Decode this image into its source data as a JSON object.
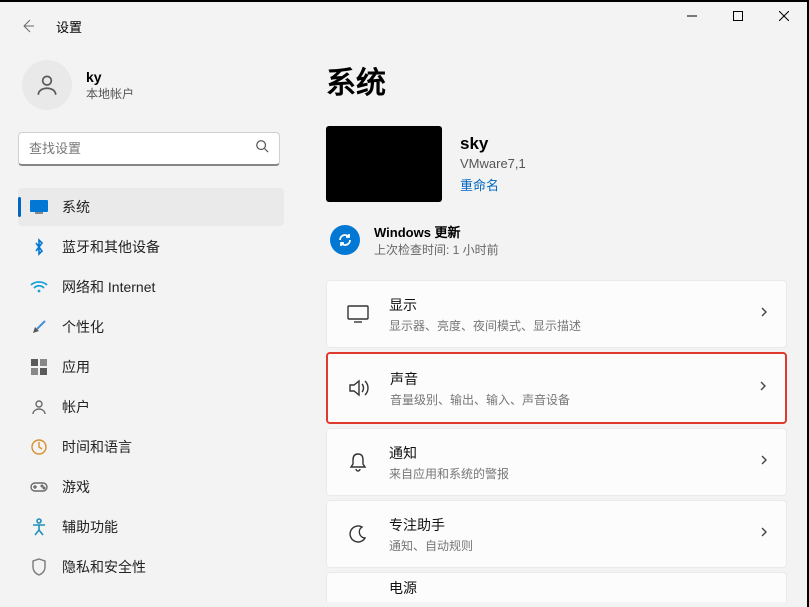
{
  "window": {
    "title": "设置"
  },
  "user": {
    "name": "ky",
    "type": "本地帐户"
  },
  "search": {
    "placeholder": "查找设置"
  },
  "nav": {
    "items": [
      {
        "label": "系统"
      },
      {
        "label": "蓝牙和其他设备"
      },
      {
        "label": "网络和 Internet"
      },
      {
        "label": "个性化"
      },
      {
        "label": "应用"
      },
      {
        "label": "帐户"
      },
      {
        "label": "时间和语言"
      },
      {
        "label": "游戏"
      },
      {
        "label": "辅助功能"
      },
      {
        "label": "隐私和安全性"
      }
    ]
  },
  "page": {
    "title": "系统",
    "host": {
      "name": "sky",
      "model": "VMware7,1",
      "rename": "重命名"
    },
    "update": {
      "title": "Windows 更新",
      "sub": "上次检查时间: 1 小时前"
    },
    "cards": [
      {
        "title": "显示",
        "sub": "显示器、亮度、夜间模式、显示描述"
      },
      {
        "title": "声音",
        "sub": "音量级别、输出、输入、声音设备"
      },
      {
        "title": "通知",
        "sub": "来自应用和系统的警报"
      },
      {
        "title": "专注助手",
        "sub": "通知、自动规则"
      },
      {
        "title": "电源",
        "sub": ""
      }
    ]
  }
}
